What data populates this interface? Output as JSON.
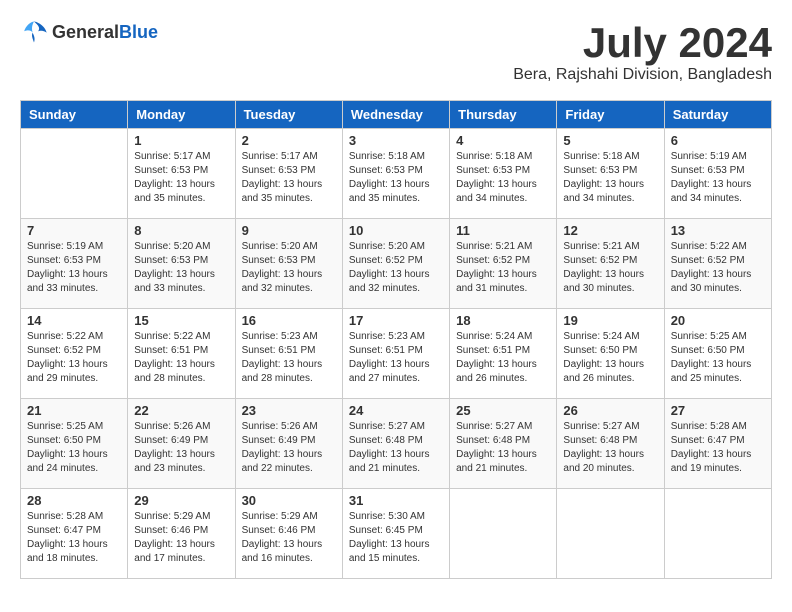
{
  "header": {
    "logo_general": "General",
    "logo_blue": "Blue",
    "month": "July 2024",
    "location": "Bera, Rajshahi Division, Bangladesh"
  },
  "weekdays": [
    "Sunday",
    "Monday",
    "Tuesday",
    "Wednesday",
    "Thursday",
    "Friday",
    "Saturday"
  ],
  "weeks": [
    [
      {
        "day": "",
        "sunrise": "",
        "sunset": "",
        "daylight": ""
      },
      {
        "day": "1",
        "sunrise": "5:17 AM",
        "sunset": "6:53 PM",
        "daylight": "13 hours and 35 minutes."
      },
      {
        "day": "2",
        "sunrise": "5:17 AM",
        "sunset": "6:53 PM",
        "daylight": "13 hours and 35 minutes."
      },
      {
        "day": "3",
        "sunrise": "5:18 AM",
        "sunset": "6:53 PM",
        "daylight": "13 hours and 35 minutes."
      },
      {
        "day": "4",
        "sunrise": "5:18 AM",
        "sunset": "6:53 PM",
        "daylight": "13 hours and 34 minutes."
      },
      {
        "day": "5",
        "sunrise": "5:18 AM",
        "sunset": "6:53 PM",
        "daylight": "13 hours and 34 minutes."
      },
      {
        "day": "6",
        "sunrise": "5:19 AM",
        "sunset": "6:53 PM",
        "daylight": "13 hours and 34 minutes."
      }
    ],
    [
      {
        "day": "7",
        "sunrise": "5:19 AM",
        "sunset": "6:53 PM",
        "daylight": "13 hours and 33 minutes."
      },
      {
        "day": "8",
        "sunrise": "5:20 AM",
        "sunset": "6:53 PM",
        "daylight": "13 hours and 33 minutes."
      },
      {
        "day": "9",
        "sunrise": "5:20 AM",
        "sunset": "6:53 PM",
        "daylight": "13 hours and 32 minutes."
      },
      {
        "day": "10",
        "sunrise": "5:20 AM",
        "sunset": "6:52 PM",
        "daylight": "13 hours and 32 minutes."
      },
      {
        "day": "11",
        "sunrise": "5:21 AM",
        "sunset": "6:52 PM",
        "daylight": "13 hours and 31 minutes."
      },
      {
        "day": "12",
        "sunrise": "5:21 AM",
        "sunset": "6:52 PM",
        "daylight": "13 hours and 30 minutes."
      },
      {
        "day": "13",
        "sunrise": "5:22 AM",
        "sunset": "6:52 PM",
        "daylight": "13 hours and 30 minutes."
      }
    ],
    [
      {
        "day": "14",
        "sunrise": "5:22 AM",
        "sunset": "6:52 PM",
        "daylight": "13 hours and 29 minutes."
      },
      {
        "day": "15",
        "sunrise": "5:22 AM",
        "sunset": "6:51 PM",
        "daylight": "13 hours and 28 minutes."
      },
      {
        "day": "16",
        "sunrise": "5:23 AM",
        "sunset": "6:51 PM",
        "daylight": "13 hours and 28 minutes."
      },
      {
        "day": "17",
        "sunrise": "5:23 AM",
        "sunset": "6:51 PM",
        "daylight": "13 hours and 27 minutes."
      },
      {
        "day": "18",
        "sunrise": "5:24 AM",
        "sunset": "6:51 PM",
        "daylight": "13 hours and 26 minutes."
      },
      {
        "day": "19",
        "sunrise": "5:24 AM",
        "sunset": "6:50 PM",
        "daylight": "13 hours and 26 minutes."
      },
      {
        "day": "20",
        "sunrise": "5:25 AM",
        "sunset": "6:50 PM",
        "daylight": "13 hours and 25 minutes."
      }
    ],
    [
      {
        "day": "21",
        "sunrise": "5:25 AM",
        "sunset": "6:50 PM",
        "daylight": "13 hours and 24 minutes."
      },
      {
        "day": "22",
        "sunrise": "5:26 AM",
        "sunset": "6:49 PM",
        "daylight": "13 hours and 23 minutes."
      },
      {
        "day": "23",
        "sunrise": "5:26 AM",
        "sunset": "6:49 PM",
        "daylight": "13 hours and 22 minutes."
      },
      {
        "day": "24",
        "sunrise": "5:27 AM",
        "sunset": "6:48 PM",
        "daylight": "13 hours and 21 minutes."
      },
      {
        "day": "25",
        "sunrise": "5:27 AM",
        "sunset": "6:48 PM",
        "daylight": "13 hours and 21 minutes."
      },
      {
        "day": "26",
        "sunrise": "5:27 AM",
        "sunset": "6:48 PM",
        "daylight": "13 hours and 20 minutes."
      },
      {
        "day": "27",
        "sunrise": "5:28 AM",
        "sunset": "6:47 PM",
        "daylight": "13 hours and 19 minutes."
      }
    ],
    [
      {
        "day": "28",
        "sunrise": "5:28 AM",
        "sunset": "6:47 PM",
        "daylight": "13 hours and 18 minutes."
      },
      {
        "day": "29",
        "sunrise": "5:29 AM",
        "sunset": "6:46 PM",
        "daylight": "13 hours and 17 minutes."
      },
      {
        "day": "30",
        "sunrise": "5:29 AM",
        "sunset": "6:46 PM",
        "daylight": "13 hours and 16 minutes."
      },
      {
        "day": "31",
        "sunrise": "5:30 AM",
        "sunset": "6:45 PM",
        "daylight": "13 hours and 15 minutes."
      },
      {
        "day": "",
        "sunrise": "",
        "sunset": "",
        "daylight": ""
      },
      {
        "day": "",
        "sunrise": "",
        "sunset": "",
        "daylight": ""
      },
      {
        "day": "",
        "sunrise": "",
        "sunset": "",
        "daylight": ""
      }
    ]
  ]
}
